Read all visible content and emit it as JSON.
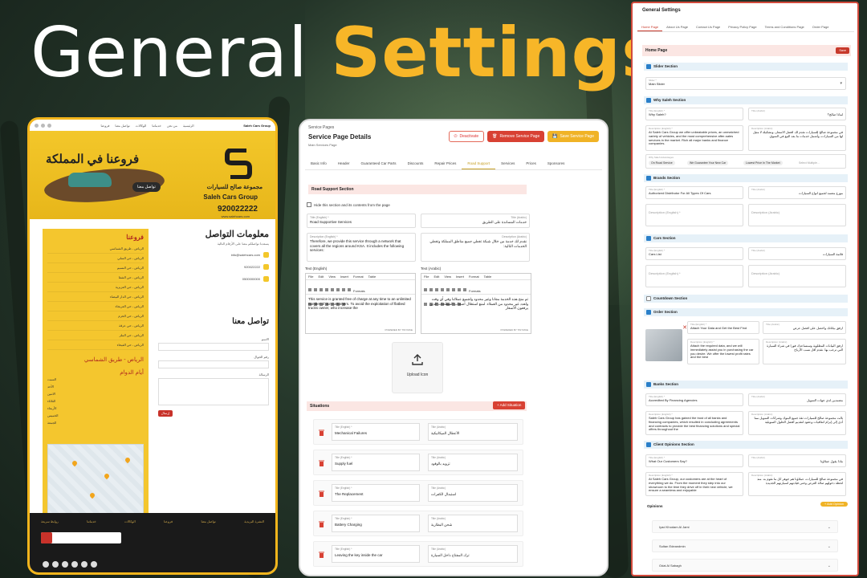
{
  "hero": {
    "word1": "General",
    "word2": "Settings"
  },
  "website": {
    "nav": [
      "الرئيسية",
      "من نحن",
      "خدماتنا",
      "الوكالات",
      "تواصل معنا",
      "فروعنا"
    ],
    "top_logo": "Saleh Cars Group",
    "banner_headline": "فروعنا في المملكة",
    "cta": "تواصل معنا",
    "brand_ar": "مجموعة صالح للسيارات",
    "brand_en": "Saleh Cars Group",
    "phone": "920022222",
    "site": "www.salehcars.com",
    "branches_title": "فروعنا",
    "branches": [
      "الرياض - طريق الشماسي",
      "الرياض - حي السلي",
      "الرياض - حي النسيم",
      "الرياض - حي الشفا",
      "الرياض - حي العزيزية",
      "الرياض - حي الدار البيضاء",
      "الرياض - حي العريجاء",
      "الرياض - حي الحزم",
      "الرياض - حي عرقة",
      "الرياض - حي الملز",
      "الرياض - حي الفيحاء"
    ],
    "selected_branch": "الرياض - طريق الشماسي",
    "hours_title": "أيام الدوام",
    "days": [
      "السبت",
      "الأحد",
      "الاثنين",
      "الثلاثاء",
      "الأربعاء",
      "الخميس",
      "الجمعة"
    ],
    "contact_title": "معلومات التواصل",
    "contact_sub": "يسعدنا تواصلكم معنا على الأرقام التالية",
    "contact_rows": [
      "info@salehcars.com",
      "920022222",
      "0500000000"
    ],
    "form_title": "تواصل معنا",
    "form_labels": [
      "الاسم",
      "رقم الجوال",
      "الرسالة"
    ],
    "send": "إرسال",
    "footer_cols": [
      "روابط سريعة",
      "خدماتنا",
      "الوكالات",
      "فروعنا",
      "تواصل معنا",
      "النشرة البريدية"
    ]
  },
  "service": {
    "breadcrumb": "Service Pages",
    "title": "Service Page Details",
    "subtitle": "Main Services Page",
    "deactivate": "Deactivate",
    "remove": "Remove Service Page",
    "save": "Save Service Page",
    "tabs": [
      "Basic Info",
      "Header",
      "Guaranteed Car Parts",
      "Discounts",
      "Repair Prices",
      "Road Support",
      "Services",
      "Prices",
      "Sponsores"
    ],
    "active_tab": "Road Support",
    "section_title": "Road Support Section",
    "hide_label": "Hide this section and its contents from the page",
    "title_en_label": "Title (English) *",
    "title_en": "Road Supportive Services",
    "title_ar_label": "Title (Arabic)",
    "title_ar": "خدمات المساندة على الطريق",
    "desc_en_label": "Description (English) *",
    "desc_en": "Therefore, we provide this service through a network that covers all the regions around KSA. It includes the following services:",
    "desc_ar_label": "Description (Arabic)",
    "desc_ar": "نقدم لك خدمة من خلال شبكة تغطي جميع مناطق المملكة وتغطي الخدمات التالية:",
    "text_en_label": "Text (English)",
    "text_ar_label": "Text (Arabic)",
    "menu": [
      "File",
      "Edit",
      "View",
      "Insert",
      "Format",
      "Table"
    ],
    "formats": "Formats",
    "text_en": "This service is granted free of charge at any time to an unlimited number of our customers. To avoid the exploitation of flatbed trucks owner, who increase the",
    "text_ar": "تم منح هذه الخدمة مجانا وغير محدود ولجميع عملائنا وفي أي وقت ولعدد غير محدود من العملاء. لمنع استغلال أصحاب السطحات الذين يرفعون الأسعار",
    "powered_en": "POWERED BY TINYMCE",
    "powered_ar": "POWERED BY TINYMCE",
    "upload_label": "Upload Icon",
    "situations_title": "Situations",
    "add_situation": "+ Add Situation",
    "sit_en_label": "Title (English) *",
    "sit_ar_label": "Title (Arabic)",
    "situations": [
      {
        "en": "Mechanical Failures",
        "ar": "الأعطال الميكانيكية"
      },
      {
        "en": "Supply fuel",
        "ar": "تزويد بالوقود"
      },
      {
        "en": "The Replacement",
        "ar": "استبدال الكفرات"
      },
      {
        "en": "Battery Charging",
        "ar": "شحن البطارية"
      },
      {
        "en": "Leaving the key inside the car",
        "ar": "ترك المفتاح داخل السيارة"
      }
    ]
  },
  "settings": {
    "title": "General Settings",
    "tabs": [
      "Home Page",
      "About Us Page",
      "Contact Us Page",
      "Privacy Policy Page",
      "Terms and Conditions Page",
      "Order Page"
    ],
    "active_tab": "Home Page",
    "page_head": "Home Page",
    "save": "Save",
    "sections": [
      {
        "label": "Slider Section",
        "checked": true
      },
      {
        "label": "Why Saleh Section",
        "checked": true
      },
      {
        "label": "Brands Section",
        "checked": true
      },
      {
        "label": "Cars Section",
        "checked": true
      },
      {
        "label": "Countdown Section",
        "checked": false
      },
      {
        "label": "Order Section",
        "checked": true
      },
      {
        "label": "Banks Section",
        "checked": true
      },
      {
        "label": "Client Opinions Section",
        "checked": true
      }
    ],
    "slider_label": "Slider *",
    "slider_value": "Main Slider",
    "title_en_label": "Title (English) *",
    "title_ar_label": "Title (Arabic)",
    "desc_en_label": "Description (English) *",
    "desc_ar_label": "Description (Arabic)",
    "why_title_en": "Why Saleh?",
    "why_title_ar": "لماذا صالح؟",
    "why_desc_en": "At Saleh Cars Group we offer unbeatable prices, an unmatched variety of vehicles, and the most comprehensive after-sales services in the market. Rich all major banks and finance companies.",
    "why_desc_ar": "في مجموعة صالح للسيارات نقدم لك أفضل الأسعار، وتشكيلة لا مثيل لها من السيارات، وأشمل خدمات ما بعد البيع في السوق.",
    "chips_label": "Why Saleh Advantages",
    "chips": [
      "On Road Service",
      "We Guarantee Your New Car",
      "Lowest Price In The Market"
    ],
    "chips_placeholder": "Select Multiple...",
    "brands_title_en": "Authorized Distributor For All Types Of Cars",
    "brands_title_ar": "موزع معتمد لجميع أنواع السيارات",
    "cars_title_en": "Cars List",
    "cars_title_ar": "قائمة السيارات",
    "order_title_en": "Attach Your Data and Get the Best Find",
    "order_title_ar": "أرفق بياناتك واحصل على أفضل عرض",
    "order_desc_en": "Attach the required data, and we will immediately assist you in purchasing the car you desire. We offer the lowest profit rates and the best",
    "order_desc_ar": "أرفق البيانات المطلوبة وسنساعدك فورا في شراء السيارة التي ترغب بها. نقدم أقل نسب الأرباح",
    "banks_title_en": "Accredited By Financing Agencies",
    "banks_title_ar": "معتمدين لدى جهات التمويل",
    "banks_desc_en": "Saleh Cars Group has gained the trust of all banks and financing companies, which resulted in concluding agreements and contracts to provide the best financing solutions and special offers throughout the",
    "banks_desc_ar": "نالت مجموعة صالح للسيارات ثقة جميع البنوك وشركات التمويل مما أدى إلى إبرام اتفاقيات وعقود لتقديم أفضل الحلول التمويلية",
    "opinions_title_en": "What Our Customers Say?",
    "opinions_title_ar": "ماذا يقول عملاؤنا",
    "opinions_desc_en": "At Saleh Cars Group, our customers are at the heart of everything we do. From the moment they step into our showroom to the time they drive off in their new vehicle, we ensure a seamless and enjoyable",
    "opinions_desc_ar": "في مجموعة صالح للسيارات، عملاؤنا هم جوهر كل ما نقوم به. منذ لحظة دخولهم صالة العرض وحتى قيادتهم لسيارتهم الجديدة",
    "opinions_label": "Opinions",
    "add_opinion": "+ Add Opinion",
    "opinions": [
      "Iyad Khodam Al Jami",
      "Sultan Edeandmin",
      "Odai Al Sabagh"
    ]
  },
  "colors": {
    "accent": "#f7b628",
    "danger": "#d84133",
    "panel_border": "#d24a3c",
    "info": "#2a7fc9"
  }
}
